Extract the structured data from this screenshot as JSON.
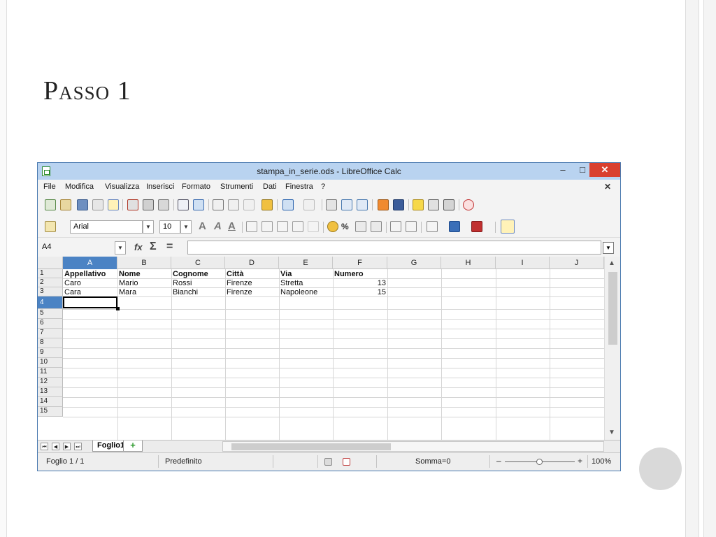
{
  "slide": {
    "title": "Passo 1"
  },
  "window": {
    "title": "stampa_in_serie.ods - LibreOffice Calc",
    "minimize": "–",
    "maximize": "□",
    "close": "✕"
  },
  "menu": {
    "items": [
      "File",
      "Modifica",
      "Visualizza",
      "Inserisci",
      "Formato",
      "Strumenti",
      "Dati",
      "Finestra",
      "?"
    ],
    "close": "✕"
  },
  "format_toolbar": {
    "font_name": "Arial",
    "font_size": "10"
  },
  "formula_bar": {
    "cell_ref": "A4",
    "fx": "fx",
    "sum": "Σ",
    "equals": "="
  },
  "sheet": {
    "columns": [
      "A",
      "B",
      "C",
      "D",
      "E",
      "F",
      "G",
      "H",
      "I",
      "J"
    ],
    "rows": [
      "1",
      "2",
      "3",
      "4",
      "5",
      "6",
      "7",
      "8",
      "9",
      "10",
      "11",
      "12",
      "13",
      "14",
      "15"
    ],
    "headers": [
      "Appellativo",
      "Nome",
      "Cognome",
      "Città",
      "Via",
      "Numero"
    ],
    "records": [
      [
        "Caro",
        "Mario",
        "Rossi",
        "Firenze",
        "Stretta",
        "13"
      ],
      [
        "Cara",
        "Mara",
        "Bianchi",
        "Firenze",
        "Napoleone",
        "15"
      ]
    ],
    "active_cell": "A4"
  },
  "tabs": {
    "sheet_name": "Foglio1",
    "add": "+"
  },
  "status": {
    "sheet": "Foglio 1 / 1",
    "style": "Predefinito",
    "sum": "Somma=0",
    "zoom_minus": "–",
    "zoom_plus": "+",
    "zoom": "100%"
  },
  "colors": {
    "accent": "#4b83c4",
    "titlebar": "#b9d3f0",
    "close": "#d9402f"
  }
}
